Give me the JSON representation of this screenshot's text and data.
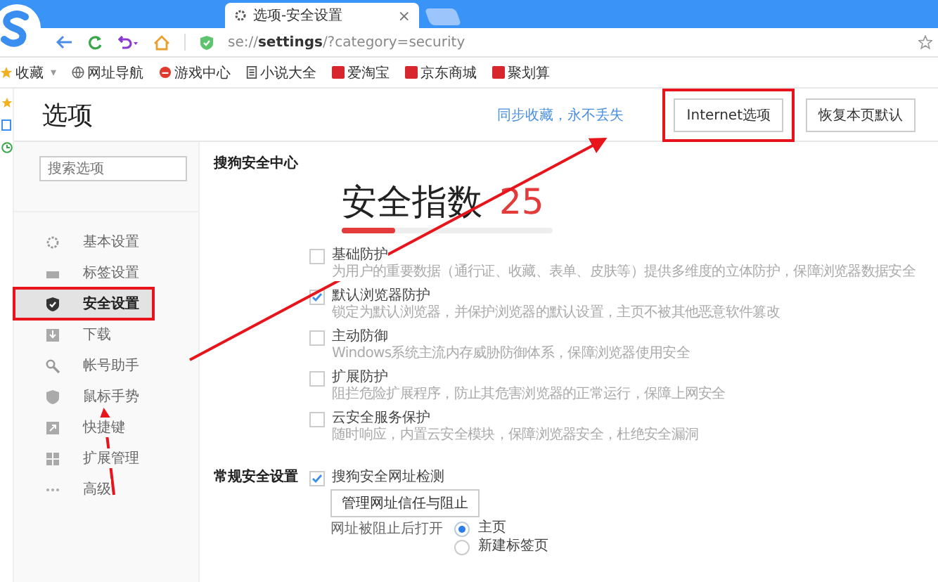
{
  "browser": {
    "tab_title": "选项-安全设置",
    "tab_close": "×",
    "url": "se://**settings**/?category=security",
    "bookmarks": [
      {
        "label": "收藏",
        "caret": "▾"
      },
      {
        "label": "网址导航"
      },
      {
        "label": "游戏中心"
      },
      {
        "label": "小说大全"
      },
      {
        "label": "爱淘宝"
      },
      {
        "label": "京东商城"
      },
      {
        "label": "聚划算"
      }
    ]
  },
  "settings": {
    "title": "选项",
    "sync_link": "同步收藏，永不丢失",
    "buttons": [
      {
        "label": "Internet选项",
        "highlighted": true
      },
      {
        "label": "恢复本页默认",
        "highlighted": false
      }
    ],
    "search": {
      "placeholder": "搜索选项"
    },
    "nav": [
      {
        "label": "基本设置",
        "selected": false,
        "highlighted": false
      },
      {
        "label": "标签设置",
        "selected": false,
        "highlighted": false
      },
      {
        "label": "安全设置",
        "selected": true,
        "highlighted": true
      },
      {
        "label": "下载",
        "selected": false,
        "highlighted": false
      },
      {
        "label": "帐号助手",
        "selected": false,
        "highlighted": false
      },
      {
        "label": "鼠标手势",
        "selected": false,
        "highlighted": false
      },
      {
        "label": "快捷键",
        "selected": false,
        "highlighted": false
      },
      {
        "label": "扩展管理",
        "selected": false,
        "highlighted": false
      },
      {
        "label": "高级",
        "selected": false,
        "highlighted": false
      }
    ]
  },
  "security": {
    "heading": "搜狗安全中心",
    "score_label": "安全指数",
    "score": "25",
    "level": 0.25,
    "options": [
      {
        "label": "基础防护",
        "desc": "为用户的重要数据（通行证、收藏、表单、皮肤等）提供多维度的立体防护，保障浏览器数据安全",
        "checked": false
      },
      {
        "label": "默认浏览器防护",
        "desc": "锁定为默认浏览器，并保护浏览器的默认设置，主页不被其他恶意软件篡改",
        "checked": true
      },
      {
        "label": "主动防御",
        "desc": "Windows系统主流内存威胁防御体系，保障浏览器使用安全",
        "checked": false
      },
      {
        "label": "扩展防护",
        "desc": "阻拦危险扩展程序，防止其危害浏览器的正常运行，保障上网安全",
        "checked": false
      },
      {
        "label": "云安全服务保护",
        "desc": "随时响应，内置云安全模块，保障浏览器安全，杜绝安全漏洞",
        "checked": false
      }
    ]
  },
  "general": {
    "heading": "常规安全设置",
    "checkbox": {
      "label": "搜狗安全网址检测",
      "checked": true
    },
    "button": "管理网址信任与阻止",
    "radio_label": "网址被阻止后打开",
    "radios": [
      {
        "label": "主页",
        "selected": true
      },
      {
        "label": "新建标签页",
        "selected": false
      }
    ]
  }
}
